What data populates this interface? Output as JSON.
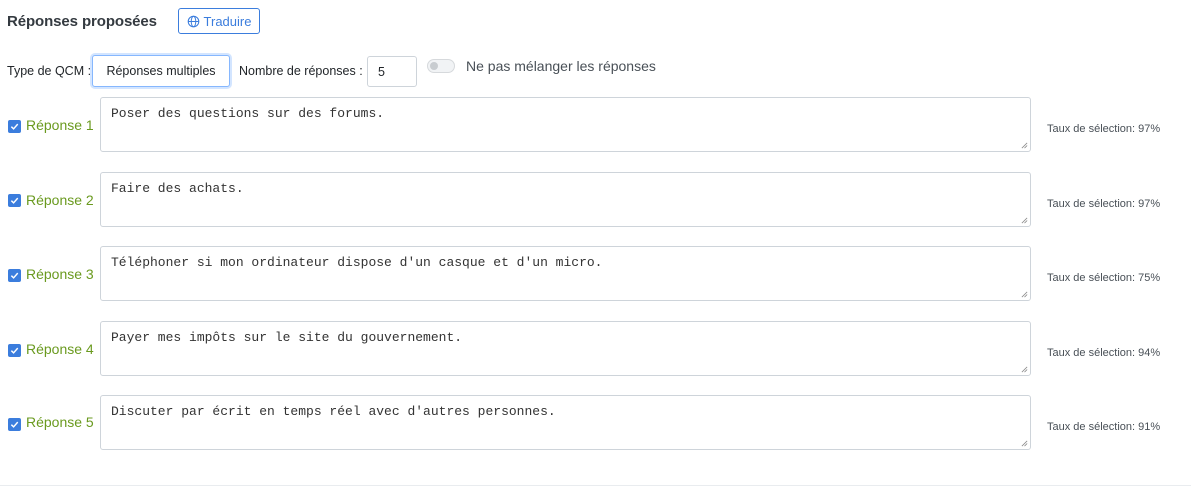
{
  "header": {
    "title": "Réponses proposées",
    "translate_label": "Traduire"
  },
  "options": {
    "type_label": "Type de QCM :",
    "type_value": "Réponses multiples",
    "count_label": "Nombre de réponses :",
    "count_value": "5",
    "shuffle_label": "Ne pas mélanger les réponses",
    "shuffle_on": false
  },
  "answers": [
    {
      "label": "Réponse 1",
      "text": "Poser des questions sur des forums.",
      "rate": "Taux de sélection: 97%",
      "checked": true
    },
    {
      "label": "Réponse 2",
      "text": "Faire des achats.",
      "rate": "Taux de sélection: 97%",
      "checked": true
    },
    {
      "label": "Réponse 3",
      "text": "Téléphoner si mon ordinateur dispose d'un casque et d'un micro.",
      "rate": "Taux de sélection: 75%",
      "checked": true
    },
    {
      "label": "Réponse 4",
      "text": "Payer mes impôts sur le site du gouvernement.",
      "rate": "Taux de sélection: 94%",
      "checked": true
    },
    {
      "label": "Réponse 5",
      "text": "Discuter par écrit en temps réel avec d'autres personnes.",
      "rate": "Taux de sélection: 91%",
      "checked": true
    }
  ],
  "colors": {
    "accent": "#3b7ddd",
    "answer_label": "#6a9a1f"
  }
}
